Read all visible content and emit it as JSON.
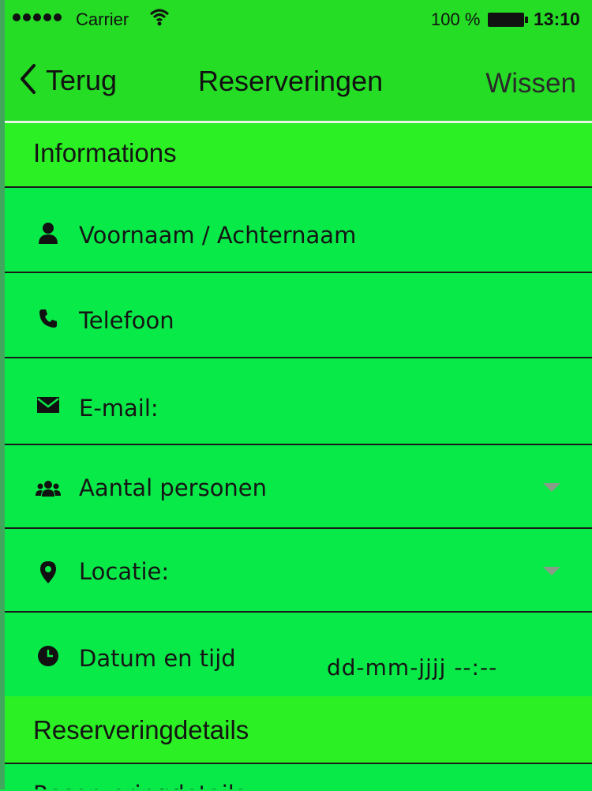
{
  "status_bar": {
    "carrier": "Carrier",
    "battery": "100 %",
    "time": "13:10"
  },
  "nav": {
    "back_label": "Terug",
    "title": "Reserveringen",
    "clear_label": "Wissen"
  },
  "sections": {
    "informations": "Informations",
    "details": "Reserveringdetails"
  },
  "fields": {
    "name": "Voornaam / Achternaam",
    "phone": "Telefoon",
    "email": "E-mail:",
    "persons": "Aantal personen",
    "location": "Locatie:",
    "datetime": "Datum en tijd",
    "datetime_value": "dd-mm-jjjj  --:--",
    "details_partial": "Reserveringdetails"
  },
  "icons": {
    "name": "person-icon",
    "phone": "phone-icon",
    "email": "envelope-icon",
    "persons": "group-icon",
    "location": "map-pin-icon",
    "datetime": "clock-icon"
  },
  "colors": {
    "background": "#08ea48",
    "header": "#25dd25",
    "section": "#2af024"
  }
}
